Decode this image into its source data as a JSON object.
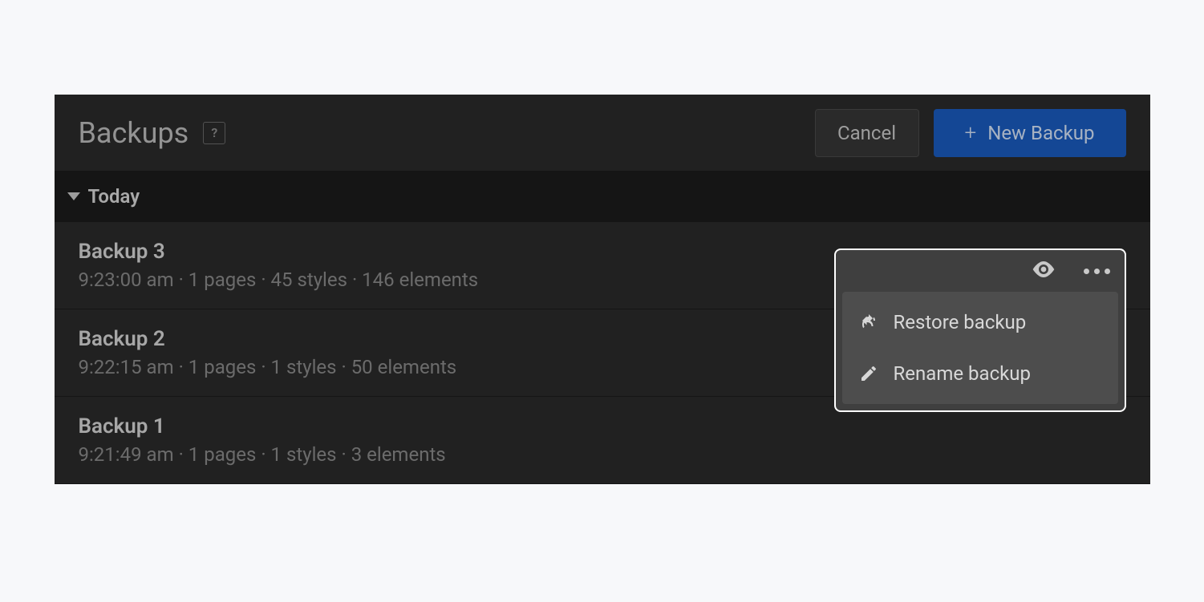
{
  "header": {
    "title": "Backups",
    "help_glyph": "?",
    "cancel_label": "Cancel",
    "new_backup_label": "New Backup"
  },
  "section": {
    "label": "Today"
  },
  "backups": [
    {
      "name": "Backup 3",
      "meta": "9:23:00 am · 1 pages · 45 styles · 146 elements"
    },
    {
      "name": "Backup 2",
      "meta": "9:22:15 am · 1 pages · 1 styles · 50 elements"
    },
    {
      "name": "Backup 1",
      "meta": "9:21:49 am · 1 pages · 1 styles · 3 elements"
    }
  ],
  "popover": {
    "restore_label": "Restore backup",
    "rename_label": "Rename backup"
  }
}
